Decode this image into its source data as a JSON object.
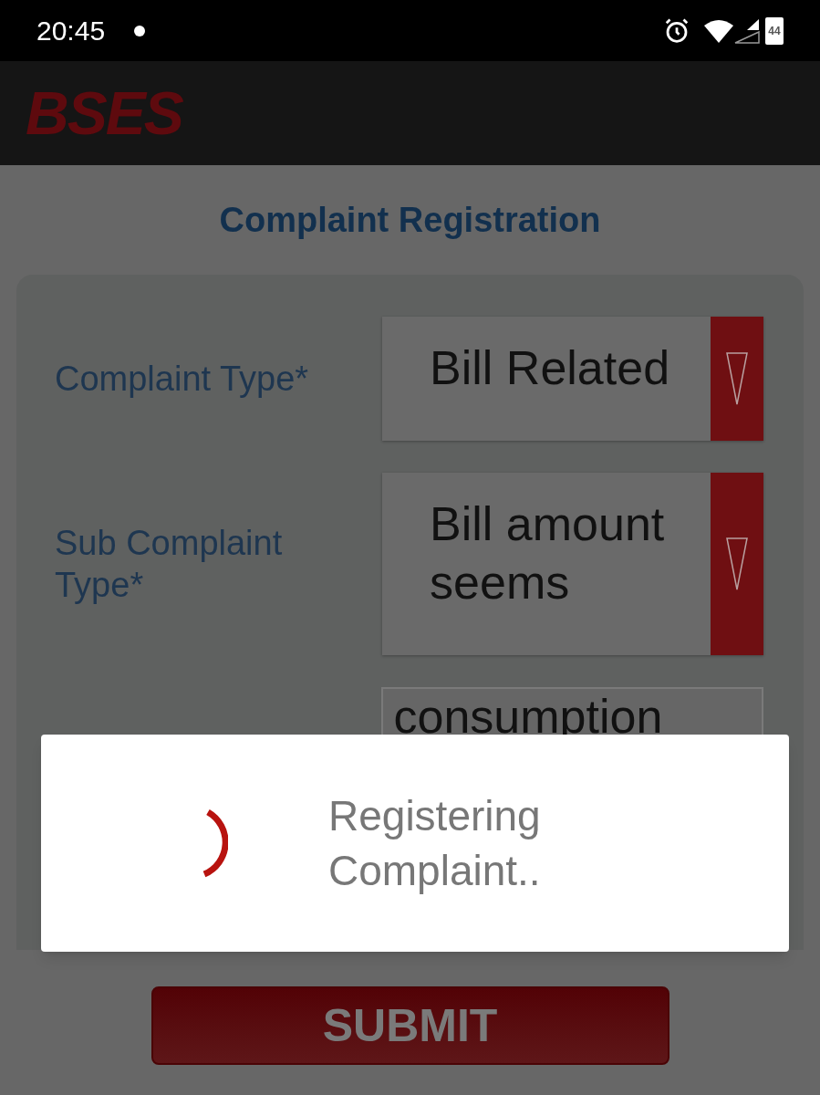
{
  "status_bar": {
    "time": "20:45",
    "battery": "44"
  },
  "app_bar": {
    "logo": "BSES"
  },
  "title": "Complaint Registration",
  "form": {
    "fields": [
      {
        "kind": "dropdown",
        "label": "Complaint Type*",
        "value": "Bill Related"
      },
      {
        "kind": "dropdown",
        "label": "Sub Complaint Type*",
        "value": "Bill amount seems"
      },
      {
        "kind": "text",
        "value": "consumption"
      }
    ]
  },
  "dialog": {
    "message": "Registering Complaint.."
  },
  "submit": {
    "label": "SUBMIT"
  }
}
